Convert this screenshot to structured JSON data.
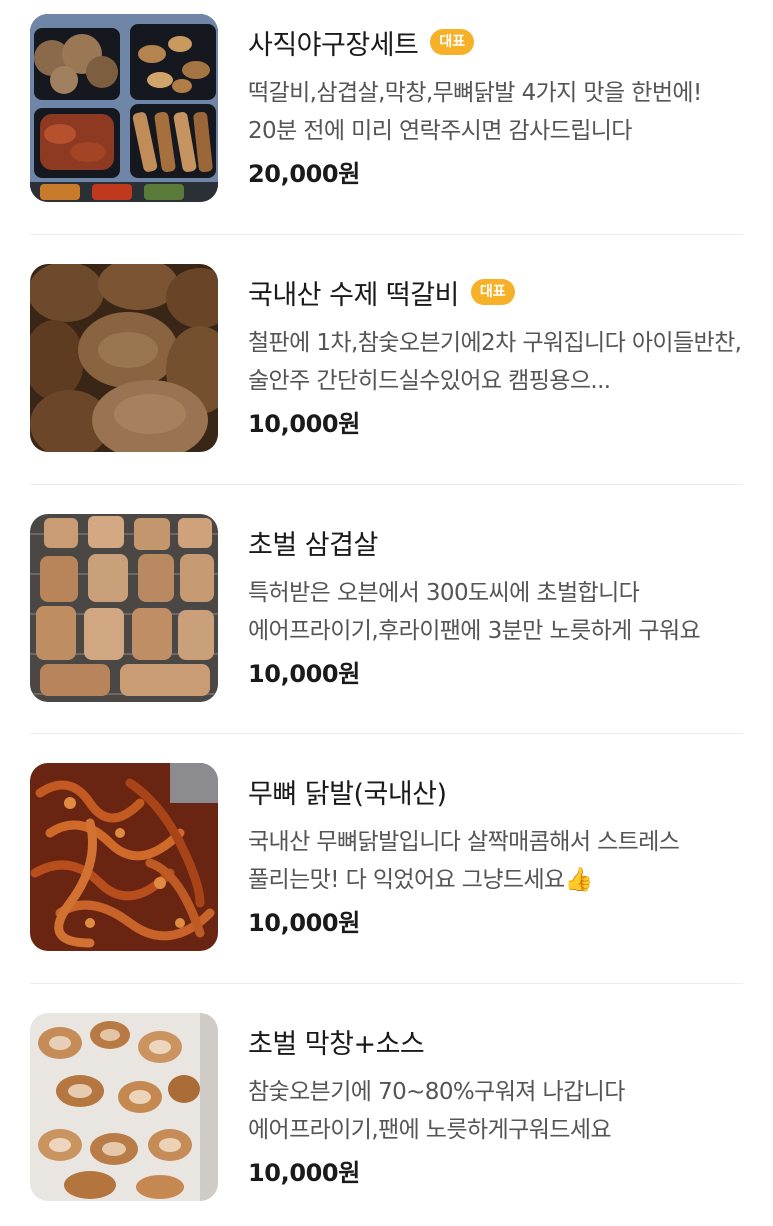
{
  "colors": {
    "badge_bg": "#f6b129",
    "badge_text": "#ffffff",
    "title": "#1a1a1a",
    "description": "#555555",
    "divider": "#ececec"
  },
  "items": [
    {
      "title": "사직야구장세트",
      "badge": "대표",
      "description": "떡갈비,삼겹살,막창,무뼈닭발 4가지 맛을 한번에! 20분 전에 미리 연락주시면 감사드립니다",
      "price": "20,000원",
      "image": "bento-box-photo"
    },
    {
      "title": "국내산 수제 떡갈비",
      "badge": "대표",
      "description": "철판에 1차,참숯오븐기에2차 구워집니다 아이들반찬,술안주 간단히드실수있어요 캠핑용으...",
      "price": "10,000원",
      "image": "tteokgalbi-photo"
    },
    {
      "title": "초벌 삼겹살",
      "badge": "",
      "description": "특허받은 오븐에서 300도씨에 초벌합니다 에어프라이기,후라이팬에 3분만 노릇하게 구워요",
      "price": "10,000원",
      "image": "pork-belly-photo"
    },
    {
      "title": "무뼈 닭발(국내산)",
      "badge": "",
      "description": "국내산 무뼈닭발입니다 살짝매콤해서 스트레스 풀리는맛! 다 익었어요 그냥드세요👍",
      "price": "10,000원",
      "image": "chicken-feet-photo"
    },
    {
      "title": "초벌 막창+소스",
      "badge": "",
      "description": "참숯오븐기에 70~80%구워져 나갑니다 에어프라이기,팬에 노릇하게구워드세요",
      "price": "10,000원",
      "image": "makchang-photo"
    }
  ]
}
